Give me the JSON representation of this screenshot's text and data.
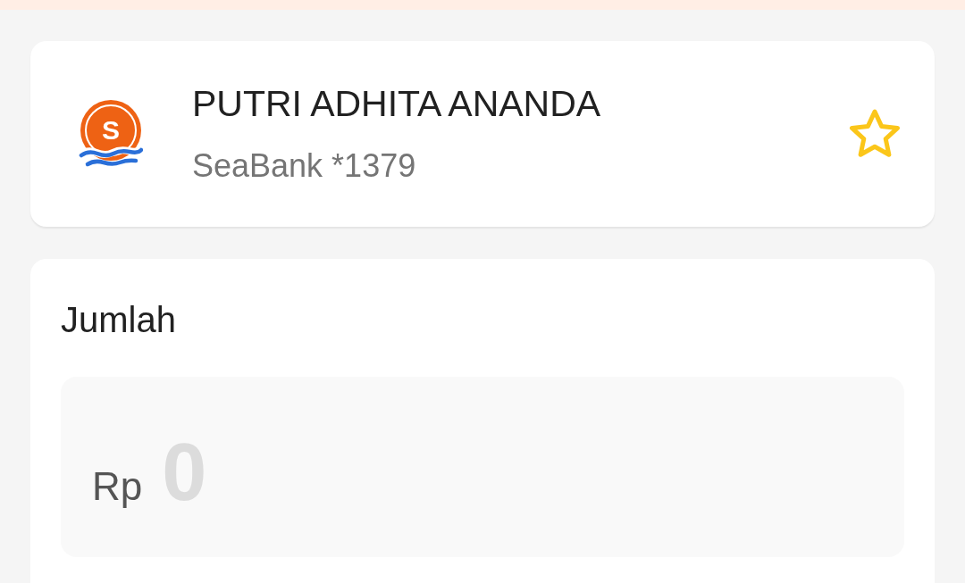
{
  "recipient": {
    "logo_letter": "S",
    "name": "PUTRI ADHITA ANANDA",
    "account": "SeaBank *1379",
    "favorite": false
  },
  "amount": {
    "label": "Jumlah",
    "currency": "Rp",
    "placeholder": "0"
  }
}
